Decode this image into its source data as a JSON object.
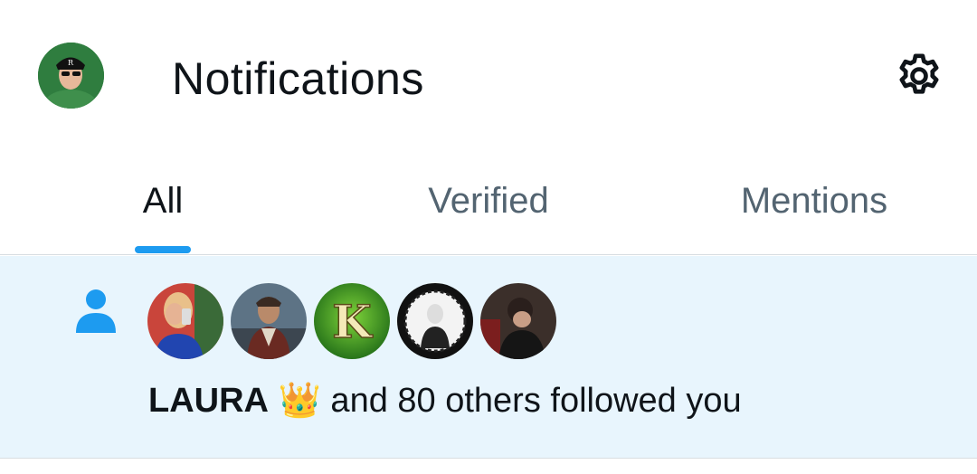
{
  "header": {
    "title": "Notifications",
    "avatar_icon": "user-avatar",
    "settings_icon": "gear-icon"
  },
  "tabs": [
    {
      "label": "All",
      "active": true
    },
    {
      "label": "Verified",
      "active": false
    },
    {
      "label": "Mentions",
      "active": false
    }
  ],
  "notification": {
    "type_icon": "person-follow-icon",
    "actor_name": "LAURA",
    "actor_emoji": "👑",
    "message": " and 80 others followed you",
    "follower_avatars": [
      "follower-avatar-1",
      "follower-avatar-2",
      "follower-avatar-3",
      "follower-avatar-4",
      "follower-avatar-5"
    ]
  },
  "colors": {
    "accent": "#1d9bf0",
    "highlight_bg": "#e8f5fd",
    "muted_text": "#536471",
    "primary_text": "#0f1419"
  }
}
